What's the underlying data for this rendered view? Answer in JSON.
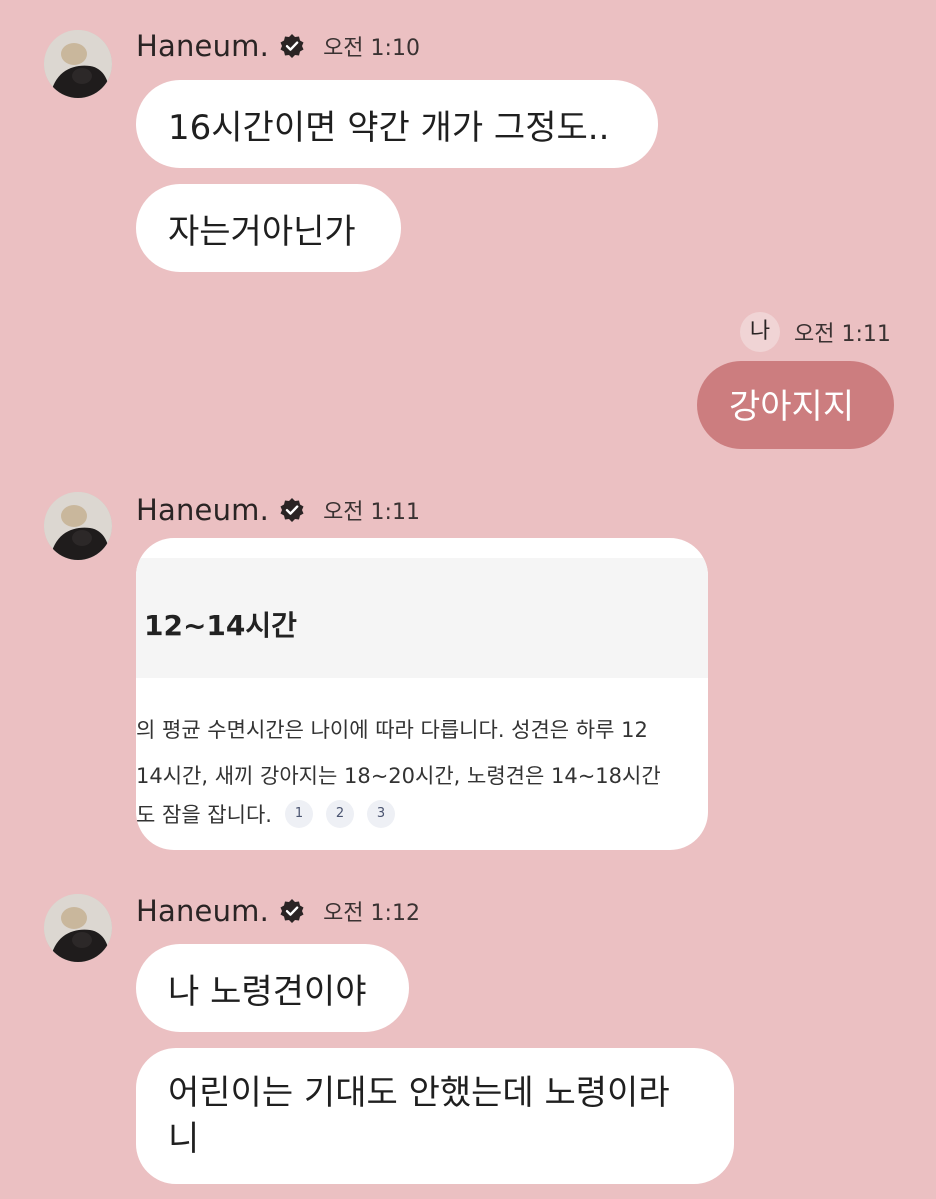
{
  "messages": [
    {
      "sender": "Haneum.",
      "time": "오전 1:10",
      "bubbles": [
        "16시간이면 약간 개가 그정도..",
        "자는거아닌가"
      ]
    },
    {
      "sender_tag": "나",
      "time": "오전 1:11",
      "bubbles": [
        "강아지지"
      ]
    },
    {
      "sender": "Haneum.",
      "time": "오전 1:11",
      "card": {
        "title": "12~14시간",
        "lines": [
          "의 평균 수면시간은 나이에 따라 다릅니다. 성견은 하루 12",
          "14시간, 새끼 강아지는 18~20시간, 노령견은 14~18시간",
          "도 잠을 잡니다."
        ],
        "citations": [
          "1",
          "2",
          "3"
        ]
      }
    },
    {
      "sender": "Haneum.",
      "time": "오전 1:12",
      "bubbles": [
        "나 노령견이야",
        "어린이는 기대도 안했는데 노령이라니"
      ]
    }
  ],
  "icons": {
    "verified": "verified-badge-icon",
    "avatar": "profile-photo"
  },
  "colors": {
    "background": "#ebc0c2",
    "incoming_bubble": "#ffffff",
    "outgoing_bubble": "#cc7d7f"
  }
}
